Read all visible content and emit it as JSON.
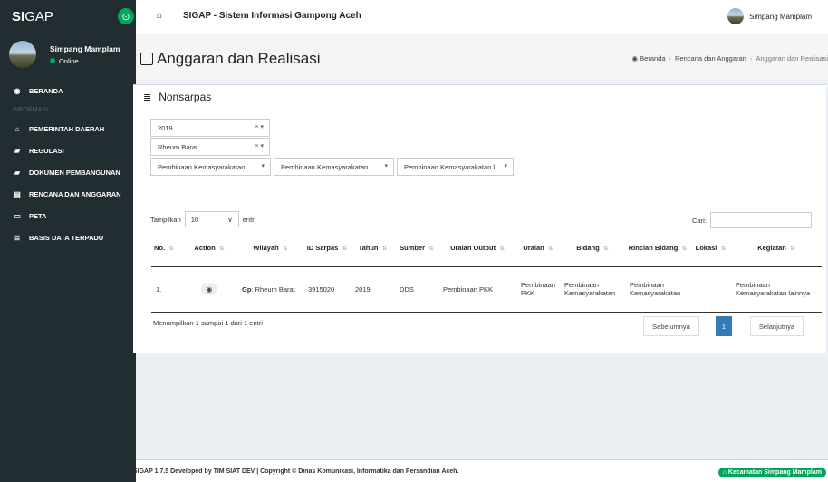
{
  "brand": {
    "bold": "SI",
    "rest": "GAP"
  },
  "sidebar": {
    "user_name": "Simpang Mamplam",
    "status": "Online",
    "items": [
      {
        "icon": "tachometer-icon",
        "glyph": "◉",
        "label": "BERANDA"
      },
      {
        "header": "INFORMASI"
      },
      {
        "icon": "institution-icon",
        "glyph": "⌂",
        "label": "PEMERINTAH DAERAH"
      },
      {
        "icon": "book-icon",
        "glyph": "▰",
        "label": "REGULASI"
      },
      {
        "icon": "book-icon",
        "glyph": "▰",
        "label": "DOKUMEN PEMBANGUNAN"
      },
      {
        "icon": "file-icon",
        "glyph": "▤",
        "label": "RENCANA DAN ANGGARAN"
      },
      {
        "icon": "map-icon",
        "glyph": "▭",
        "label": "PETA"
      },
      {
        "icon": "database-icon",
        "glyph": "≣",
        "label": "BASIS DATA TERPADU"
      }
    ]
  },
  "topbar": {
    "title": "SIGAP - Sistem Informasi Gampong Aceh",
    "user": "Simpang Mamplam"
  },
  "header": {
    "title": "Anggaran dan Realisasi",
    "breadcrumb": [
      "Beranda",
      "Rencana dan Anggaran",
      "Anggaran dan Realisasi"
    ]
  },
  "box": {
    "title": "Nonsarpas"
  },
  "filters": {
    "year": "2019",
    "gampong": "Rheum Barat",
    "bidang1": "Pembinaan Kemasyarakatan",
    "bidang2": "Pembinaan Kemasyarakatan",
    "bidang3": "Pembinaan Kemasyarakatan l..."
  },
  "table": {
    "show_label": "Tampilkan",
    "show_value": "10",
    "entries_label": "entri",
    "search_label": "Cari:",
    "columns": [
      "No.",
      "Action",
      "Wilayah",
      "ID Sarpas",
      "Tahun",
      "Sumber",
      "Uraian Output",
      "Uraian",
      "Bidang",
      "Rincian Bidang",
      "Lokasi",
      "Kegiatan"
    ],
    "row": {
      "no": "1.",
      "wilayah_prefix": "Gp",
      "wilayah": ": Rheum Barat",
      "id_sarpas": "3915020",
      "tahun": "2019",
      "sumber": "DDS",
      "uraian_output": "Pembinaan PKK",
      "uraian": "Pembinaan PKK",
      "bidang": "Pembinaan Kemasyarakatan",
      "rincian": "Pembinaan Kemasyarakatan",
      "lokasi": "",
      "kegiatan": "Pembinaan Kemasyarakatan lainnya"
    },
    "info": "Menampilkan 1 sampai 1 dari 1 entri",
    "prev": "Sebelumnya",
    "page": "1",
    "next": "Selanjutnya"
  },
  "footer": {
    "text": "SIGAP 1.7.5 Developed by TIM SIAT DEV | Copyright © Dinas Komunikasi, Informatika dan Persandian Aceh.",
    "badge": "Kecamatan Simpang Mamplam"
  }
}
